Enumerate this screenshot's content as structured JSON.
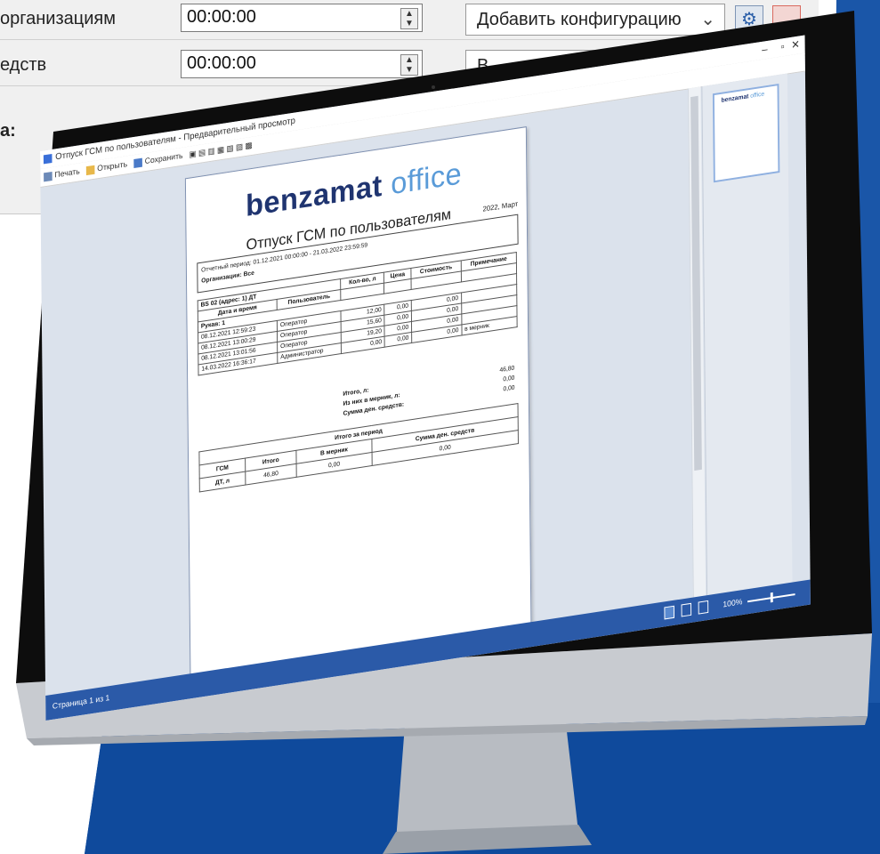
{
  "settings_panel": {
    "row1_label": "организациям",
    "row1_time": "00:00:00",
    "row1_combo": "Добавить конфигурацию",
    "row2_label": "едств",
    "row2_time": "00:00:00",
    "row2_combo": "В",
    "section_label": "а:"
  },
  "window": {
    "title": "Отпуск ГСМ по пользователям - Предварительный просмотр",
    "toolbar": {
      "print": "Печать",
      "open": "Открыть",
      "save": "Сохранить"
    }
  },
  "report": {
    "logo_main": "benzamat",
    "logo_sub": "office",
    "title": "Отпуск ГСМ по пользователям",
    "date": "2022, Март",
    "period": "Отчетный период: 01.12.2021 00:00:00 - 21.03.2022 23:59:59",
    "organizations": "Организации: Все",
    "station": "BS 02 (адрес: 1) ДТ",
    "columns": [
      "Дата и время",
      "Пользователь",
      "Кол-во, л",
      "Цена",
      "Стоимость",
      "Примечание"
    ],
    "sleeve": "Рукав: 1",
    "rows": [
      {
        "date": "08.12.2021 12:59:23",
        "user": "Оператор",
        "qty": "12,00",
        "price": "0,00",
        "cost": "0,00",
        "note": ""
      },
      {
        "date": "08.12.2021 13:00:29",
        "user": "Оператор",
        "qty": "15,60",
        "price": "0,00",
        "cost": "0,00",
        "note": ""
      },
      {
        "date": "08.12.2021 13:01:56",
        "user": "Оператор",
        "qty": "19,20",
        "price": "0,00",
        "cost": "0,00",
        "note": ""
      },
      {
        "date": "14.03.2022 16:36:17",
        "user": "Администратор",
        "qty": "0,00",
        "price": "0,00",
        "cost": "0,00",
        "note": "в мерник"
      }
    ],
    "total_label": "Итого, л:",
    "total_value": "46,80",
    "measurer_label": "Из них в мерник, л:",
    "measurer_value": "0,00",
    "money_label": "Сумма ден. средств:",
    "money_value": "0,00",
    "period_total": "Итого за период",
    "summary_cols": [
      "ГСМ",
      "Итого",
      "В мерник",
      "Сумма ден. средств"
    ],
    "summary_row": {
      "fuel": "ДТ, л",
      "total": "46,80",
      "measurer": "0,00",
      "money": "0,00"
    }
  },
  "statusbar": {
    "page_text": "Страница 1 из 1",
    "zoom": "100%"
  },
  "colors": {
    "brand_dark": "#1f3470",
    "brand_light": "#5a9bd8",
    "background_blue": "#1a56a8",
    "status_bar": "#2b5aa8"
  }
}
